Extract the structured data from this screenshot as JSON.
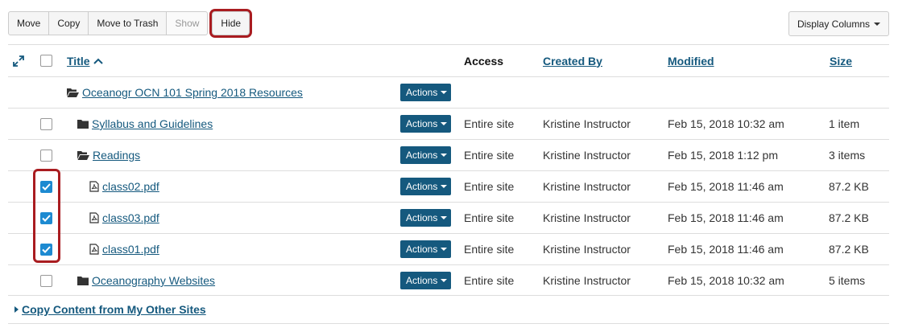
{
  "toolbar": {
    "buttons": [
      "Move",
      "Copy",
      "Move to Trash",
      "Show",
      "Hide"
    ],
    "display_columns": "Display Columns"
  },
  "columns": {
    "title": "Title",
    "access": "Access",
    "created_by": "Created By",
    "modified": "Modified",
    "size": "Size"
  },
  "rows": [
    {
      "title": "Oceanogr OCN 101 Spring 2018 Resources",
      "icon": "folder-open-icon",
      "actions": "Actions",
      "access": "",
      "created_by": "",
      "modified": "",
      "size": "",
      "checked": null
    },
    {
      "title": "Syllabus and Guidelines",
      "icon": "folder-icon",
      "actions": "Actions",
      "access": "Entire site",
      "created_by": "Kristine Instructor",
      "modified": "Feb 15, 2018 10:32 am",
      "size": "1 item",
      "checked": false
    },
    {
      "title": "Readings",
      "icon": "folder-open-icon",
      "actions": "Actions",
      "access": "Entire site",
      "created_by": "Kristine Instructor",
      "modified": "Feb 15, 2018 1:12 pm",
      "size": "3 items",
      "checked": false
    },
    {
      "title": "class02.pdf",
      "icon": "pdf-file-icon",
      "actions": "Actions",
      "access": "Entire site",
      "created_by": "Kristine Instructor",
      "modified": "Feb 15, 2018 11:46 am",
      "size": "87.2 KB",
      "checked": true
    },
    {
      "title": "class03.pdf",
      "icon": "pdf-file-icon",
      "actions": "Actions",
      "access": "Entire site",
      "created_by": "Kristine Instructor",
      "modified": "Feb 15, 2018 11:46 am",
      "size": "87.2 KB",
      "checked": true
    },
    {
      "title": "class01.pdf",
      "icon": "pdf-file-icon",
      "actions": "Actions",
      "access": "Entire site",
      "created_by": "Kristine Instructor",
      "modified": "Feb 15, 2018 11:46 am",
      "size": "87.2 KB",
      "checked": true
    },
    {
      "title": "Oceanography Websites",
      "icon": "folder-icon",
      "actions": "Actions",
      "access": "Entire site",
      "created_by": "Kristine Instructor",
      "modified": "Feb 15, 2018 10:32 am",
      "size": "5 items",
      "checked": false
    }
  ],
  "footer": {
    "copy_content": "Copy Content from My Other Sites"
  },
  "colors": {
    "link": "#15597e",
    "actions_bg": "#15597e",
    "highlight": "#a91c20",
    "checkbox_checked": "#1d8ad1"
  }
}
